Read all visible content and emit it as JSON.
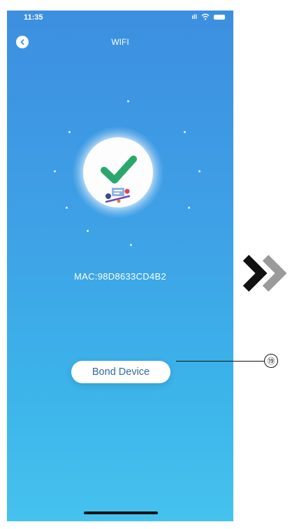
{
  "status_bar": {
    "time": "11:35"
  },
  "nav": {
    "title": "WIFI"
  },
  "device": {
    "mac": "MAC:98D8633CD4B2"
  },
  "actions": {
    "bond_label": "Bond Device"
  },
  "callout": {
    "number": "⑲"
  },
  "colors": {
    "background_top": "#3d8fe0",
    "background_bottom": "#46c2ee",
    "check": "#2aa86b",
    "button_text": "#2f6aa6"
  },
  "icons": [
    "back-icon",
    "wifi-icon",
    "battery-icon",
    "checkmark-icon",
    "chevron-right-icon"
  ]
}
